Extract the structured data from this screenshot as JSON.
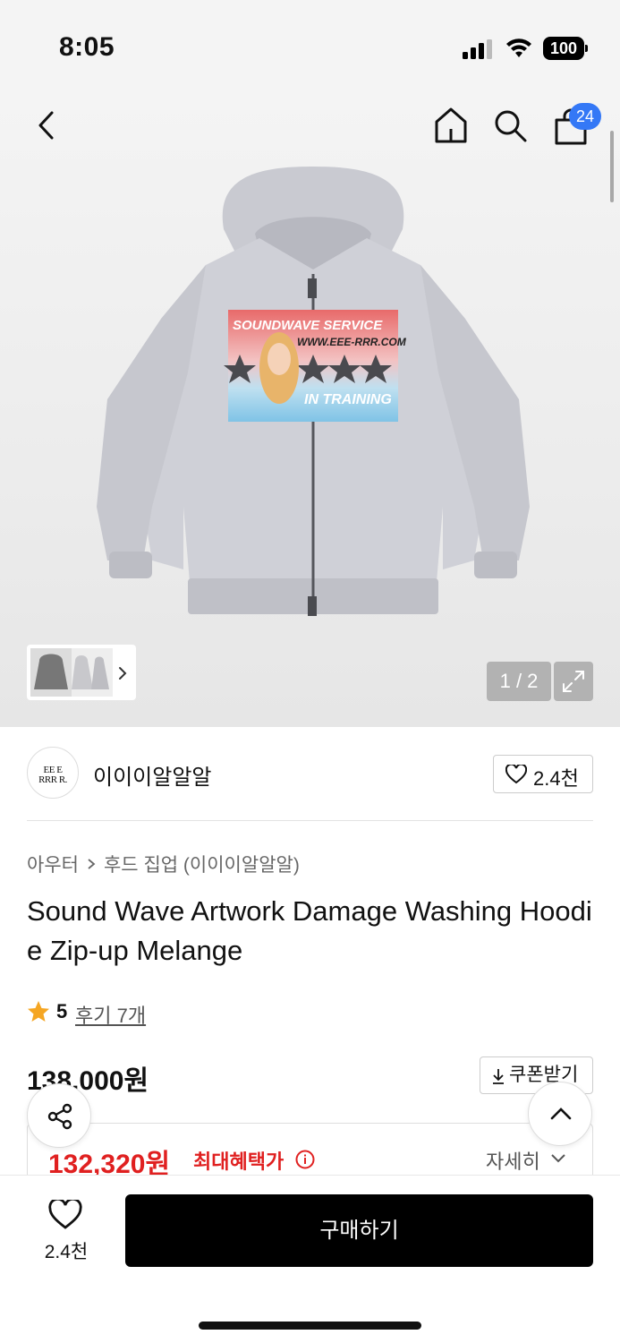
{
  "status_bar": {
    "time": "8:05",
    "battery": "100"
  },
  "header": {
    "cart_count": "24",
    "icons": [
      "back-icon",
      "home-icon",
      "search-icon",
      "shopping-bag-icon"
    ]
  },
  "gallery": {
    "page_indicator": "1 / 2",
    "print_text": {
      "line1": "SOUNDWAVE SERVICE",
      "line2": "WWW.EEE-RRR.COM",
      "line3": "IN TRAINING"
    }
  },
  "brand": {
    "logo_line1": "EE E",
    "logo_line2": "RRR R.",
    "name": "이이이알알알",
    "like_count": "2.4천"
  },
  "product": {
    "breadcrumb": [
      "아우터",
      "후드 집업 (이이이알알알)"
    ],
    "title": "Sound Wave Artwork Damage Washing Hoodie Zip-up Melange",
    "rating": "5",
    "review_link": "후기 7개",
    "original_price": "138,000원",
    "coupon_label": "쿠폰받기",
    "sale_price": "132,320원",
    "sale_label": "최대혜택가",
    "detail_label": "자세히"
  },
  "bottom_bar": {
    "like_count": "2.4천",
    "buy_label": "구매하기"
  },
  "colors": {
    "accent_blue": "#3478f6",
    "sale_red": "#e02020",
    "star_orange": "#f5a623",
    "buy_black": "#000000"
  }
}
